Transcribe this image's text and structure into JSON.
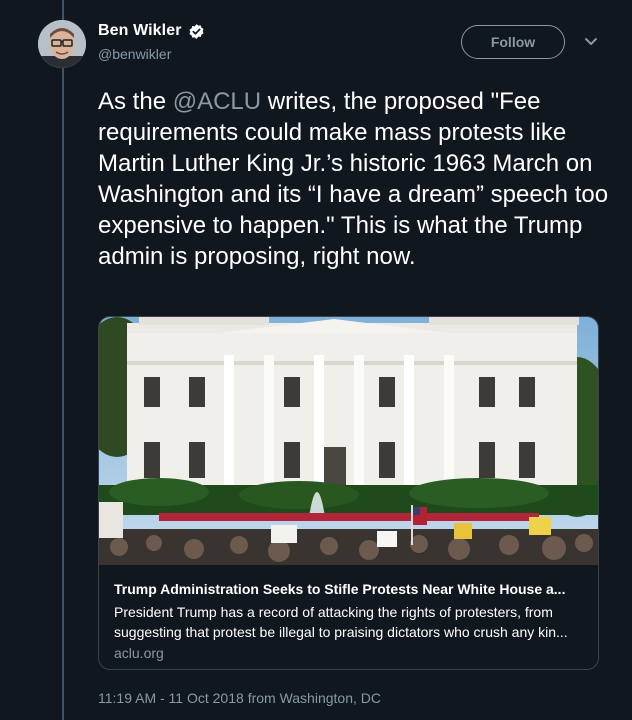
{
  "author": {
    "display_name": "Ben Wikler",
    "handle": "@benwikler",
    "verified_icon": "verified-badge-icon"
  },
  "actions": {
    "follow_label": "Follow",
    "more_icon": "chevron-down-icon"
  },
  "tweet": {
    "text_before": "As the ",
    "mention": "@ACLU",
    "text_after": " writes, the proposed \"Fee requirements could make mass protests like Martin Luther King Jr.’s historic 1963 March on Washington and its “I have a dream” speech too expensive to happen.\" This is what the Trump admin is proposing, right now."
  },
  "card": {
    "title": "Trump Administration Seeks to Stifle Protests Near White House a...",
    "description": "President Trump has a record of attacking the rights of protesters, from suggesting that protest be illegal to praising dictators who crush any kin...",
    "domain": "aclu.org"
  },
  "meta": {
    "time": "11:19 AM - 11 Oct 2018",
    "from_text": "from",
    "location": "Washington, DC"
  },
  "colors": {
    "background": "#10171e",
    "text": "#ffffff",
    "secondary": "#8899a6",
    "verified": "#ffffff",
    "border": "#38444d"
  }
}
